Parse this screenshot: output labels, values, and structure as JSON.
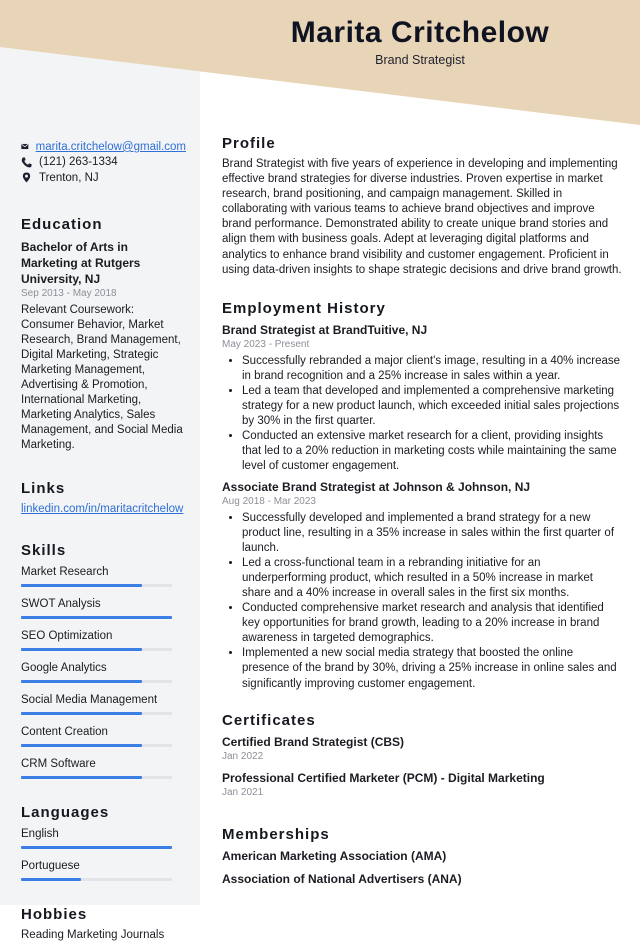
{
  "header": {
    "name": "Marita Critchelow",
    "title": "Brand Strategist",
    "band_color": "#e8d5b7"
  },
  "contact": {
    "email": "marita.critchelow@gmail.com",
    "phone": "(121) 263-1334",
    "location": "Trenton, NJ",
    "icons": [
      "envelope-icon",
      "phone-icon",
      "map-pin-icon"
    ]
  },
  "education": {
    "heading": "Education",
    "degree": "Bachelor of Arts in Marketing at Rutgers University, NJ",
    "dates": "Sep 2013 - May 2018",
    "description": "Relevant Coursework: Consumer Behavior, Market Research, Brand Management, Digital Marketing, Strategic Marketing Management, Advertising & Promotion, International Marketing, Marketing Analytics, Sales Management, and Social Media Marketing."
  },
  "links": {
    "heading": "Links",
    "items": [
      "linkedin.com/in/maritacritchelow"
    ]
  },
  "skills": {
    "heading": "Skills",
    "accent_color": "#3b7ee6",
    "items": [
      {
        "label": "Market Research",
        "level": 0.8
      },
      {
        "label": "SWOT Analysis",
        "level": 1.0
      },
      {
        "label": "SEO Optimization",
        "level": 0.8
      },
      {
        "label": "Google Analytics",
        "level": 0.8
      },
      {
        "label": "Social Media Management",
        "level": 0.8
      },
      {
        "label": "Content Creation",
        "level": 0.8
      },
      {
        "label": "CRM Software",
        "level": 0.8
      }
    ]
  },
  "languages": {
    "heading": "Languages",
    "items": [
      {
        "label": "English",
        "level": 1.0
      },
      {
        "label": "Portuguese",
        "level": 0.4
      }
    ]
  },
  "hobbies": {
    "heading": "Hobbies",
    "items": [
      "Reading Marketing Journals"
    ]
  },
  "profile": {
    "heading": "Profile",
    "text": "Brand Strategist with five years of experience in developing and implementing effective brand strategies for diverse industries. Proven expertise in market research, brand positioning, and campaign management. Skilled in collaborating with various teams to achieve brand objectives and improve brand performance. Demonstrated ability to create unique brand stories and align them with business goals. Adept at leveraging digital platforms and analytics to enhance brand visibility and customer engagement. Proficient in using data-driven insights to shape strategic decisions and drive brand growth."
  },
  "employment": {
    "heading": "Employment History",
    "jobs": [
      {
        "title": "Brand Strategist at BrandTuitive, NJ",
        "dates": "May 2023 - Present",
        "bullets": [
          "Successfully rebranded a major client's image, resulting in a 40% increase in brand recognition and a 25% increase in sales within a year.",
          "Led a team that developed and implemented a comprehensive marketing strategy for a new product launch, which exceeded initial sales projections by 30% in the first quarter.",
          "Conducted an extensive market research for a client, providing insights that led to a 20% reduction in marketing costs while maintaining the same level of customer engagement."
        ]
      },
      {
        "title": "Associate Brand Strategist at Johnson & Johnson, NJ",
        "dates": "Aug 2018 - Mar 2023",
        "bullets": [
          "Successfully developed and implemented a brand strategy for a new product line, resulting in a 35% increase in sales within the first quarter of launch.",
          "Led a cross-functional team in a rebranding initiative for an underperforming product, which resulted in a 50% increase in market share and a 40% increase in overall sales in the first six months.",
          "Conducted comprehensive market research and analysis that identified key opportunities for brand growth, leading to a 20% increase in brand awareness in targeted demographics.",
          "Implemented a new social media strategy that boosted the online presence of the brand by 30%, driving a 25% increase in online sales and significantly improving customer engagement."
        ]
      }
    ]
  },
  "certificates": {
    "heading": "Certificates",
    "items": [
      {
        "title": "Certified Brand Strategist (CBS)",
        "date": "Jan 2022"
      },
      {
        "title": "Professional Certified Marketer (PCM) - Digital Marketing",
        "date": "Jan 2021"
      }
    ]
  },
  "memberships": {
    "heading": "Memberships",
    "items": [
      "American Marketing Association (AMA)",
      "Association of National Advertisers (ANA)"
    ]
  }
}
